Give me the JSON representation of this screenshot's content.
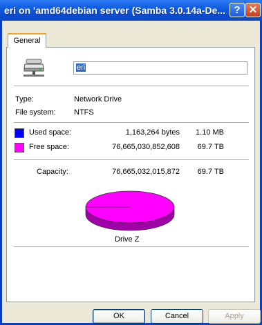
{
  "window": {
    "title": "eri on 'amd64debian server (Samba 3.0.14a-De...",
    "help_label": "?",
    "close_label": "✕"
  },
  "tabs": [
    {
      "label": "General"
    }
  ],
  "drive": {
    "name": "eri",
    "icon": "network-drive-icon",
    "type_label": "Type:",
    "type_value": "Network Drive",
    "fs_label": "File system:",
    "fs_value": "NTFS"
  },
  "space": {
    "used_label": "Used space:",
    "used_bytes": "1,163,264 bytes",
    "used_short": "1.10 MB",
    "used_color": "#0000ff",
    "free_label": "Free space:",
    "free_bytes": "76,665,030,852,608",
    "free_short": "69.7 TB",
    "free_color": "#ff00ff",
    "capacity_label": "Capacity:",
    "capacity_bytes": "76,665,032,015,872",
    "capacity_short": "69.7 TB"
  },
  "pie": {
    "caption": "Drive Z",
    "used_fraction": 1.52e-08,
    "free_fraction": 0.9999999848
  },
  "buttons": {
    "ok": "OK",
    "cancel": "Cancel",
    "apply": "Apply"
  }
}
